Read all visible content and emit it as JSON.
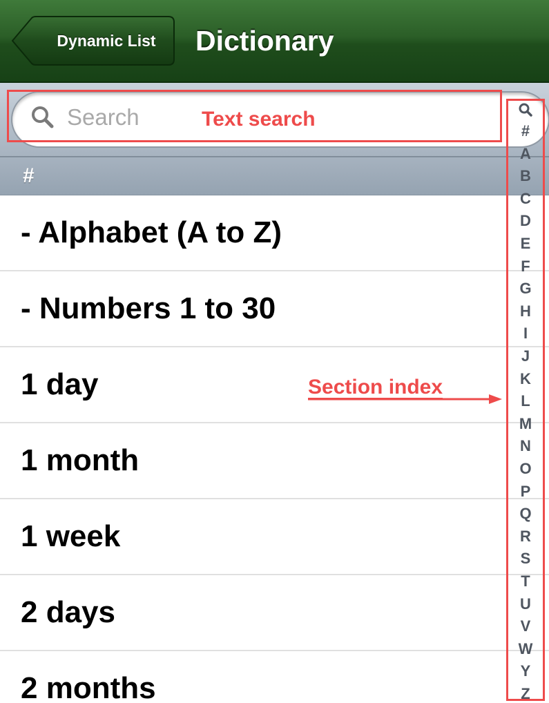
{
  "navbar": {
    "back_label": "Dynamic List",
    "title": "Dictionary"
  },
  "search": {
    "placeholder": "Search"
  },
  "section_header": "#",
  "rows": [
    "- Alphabet (A to Z)",
    "- Numbers 1 to 30",
    "1 day",
    "1 month",
    "1 week",
    "2 days",
    "2 months"
  ],
  "section_index": {
    "search_glyph": "search-icon",
    "letters": [
      "#",
      "A",
      "B",
      "C",
      "D",
      "E",
      "F",
      "G",
      "H",
      "I",
      "J",
      "K",
      "L",
      "M",
      "N",
      "O",
      "P",
      "Q",
      "R",
      "S",
      "T",
      "U",
      "V",
      "W",
      "Y",
      "Z"
    ]
  },
  "annotations": {
    "text_search": "Text search",
    "section_index": "Section index"
  },
  "colors": {
    "navbar_green": "#2b5e27",
    "annotation_red": "#ee4b4b",
    "section_header_gray": "#9aa8b6"
  }
}
